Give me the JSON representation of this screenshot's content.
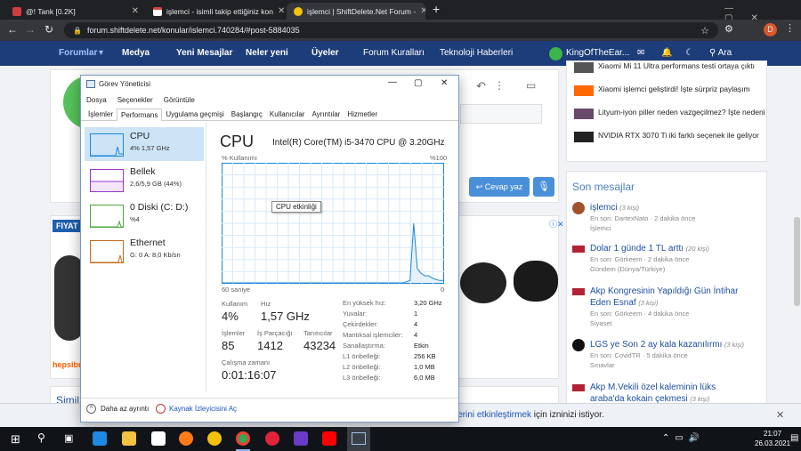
{
  "browser": {
    "tabs": [
      {
        "title": "@! Tank [0.2K]",
        "fav": "#d23c3c"
      },
      {
        "title": "işlemci - isimli takip ettiğiniz kon",
        "fav": "#d44638"
      },
      {
        "title": "işlemci | ShiftDelete.Net Forum -",
        "fav": "#f4c20d"
      }
    ],
    "new_tab": "+",
    "url": "forum.shiftdelete.net/konular/islemci.740284/#post-5884035"
  },
  "nav": {
    "items": [
      "Forumlar",
      "Medya",
      "Yeni Mesajlar",
      "Neler yeni",
      "Üyeler",
      "Forum Kuralları",
      "Teknoloji Haberleri"
    ],
    "username": "KingOfTheEar...",
    "search": "Ara"
  },
  "side_top": [
    "Xiaomi Mi 11 Ultra performans testi ortaya çıktı",
    "Xiaomi işlemci geliştirdi! İşte sürpriz paylaşım",
    "Lityum-iyon piller neden vazgeçilmez? İşte nedeni",
    "NVIDIA RTX 3070 Ti iki farklı seçenek ile geliyor"
  ],
  "reply_button": "Cevap yaz",
  "recent": {
    "title": "Son mesajlar",
    "items": [
      {
        "title": "işlemci",
        "count": "(3 kişi)",
        "line1": "En son: DartexNato · 2 dakika önce",
        "line2": "İşlemci"
      },
      {
        "title": "Dolar 1 günde 1 TL arttı",
        "count": "(20 kişi)",
        "line1": "En son: Görkeem · 2 dakika önce",
        "line2": "Gündem (Dünya/Türkiye)"
      },
      {
        "title": "Akp Kongresinin Yapıldığı Gün İntihar Eden Esnaf",
        "count": "(3 kişi)",
        "line1": "En son: Görkeem · 4 dakika önce",
        "line2": "Siyaset"
      },
      {
        "title": "LGS ye Son 2 ay kala kazanılırmı",
        "count": "(3 kişi)",
        "line1": "En son: CovidTR · 5 dakika önce",
        "line2": "Sınavlar"
      },
      {
        "title": "Akp M.Vekili özel kaleminin lüks araba'da kokain çekmesi",
        "count": "(3 kişi)",
        "line1": "",
        "line2": ""
      }
    ]
  },
  "ad": {
    "label": "FIYAT",
    "brand": "hepsibur"
  },
  "similar": "Simil",
  "notification": {
    "link": "lerini etkinleştirmek",
    "rest": " için izninizi istiyor."
  },
  "taskmgr": {
    "title": "Görev Yöneticisi",
    "menu": [
      "Dosya",
      "Seçenekler",
      "Görüntüle"
    ],
    "tabs": [
      "İşlemler",
      "Performans",
      "Uygulama geçmişi",
      "Başlangıç",
      "Kullanıcılar",
      "Ayrıntılar",
      "Hizmetler"
    ],
    "resources": [
      {
        "name": "CPU",
        "sub": "4% 1,57 GHz",
        "color": "#1a86d9"
      },
      {
        "name": "Bellek",
        "sub": "2,6/5,9 GB (44%)",
        "color": "#9b35c9"
      },
      {
        "name": "0 Diski (C: D:)",
        "sub": "%4",
        "color": "#4ba83c"
      },
      {
        "name": "Ethernet",
        "sub": "G: 0 A: 8,0 Kb/sn",
        "color": "#c66a1c"
      }
    ],
    "heading": "CPU",
    "model": "Intel(R) Core(TM) i5-3470 CPU @ 3.20GHz",
    "usage_label": "% Kullanımı",
    "usage_max": "%100",
    "time_left": "60 saniye",
    "time_right": "0",
    "tooltip": "CPU etkinliği",
    "graph": [
      0,
      0,
      0,
      0,
      0,
      0,
      0,
      0,
      0,
      0,
      0,
      0,
      0,
      0,
      0,
      0,
      0,
      0,
      0,
      0,
      0,
      0,
      0,
      0,
      0,
      0,
      0,
      0,
      0,
      0,
      0,
      0,
      0,
      0,
      0,
      0,
      0,
      0,
      0,
      0,
      0,
      0,
      0,
      0,
      0,
      0,
      0,
      0,
      0,
      0,
      1,
      2,
      50,
      12,
      8,
      6,
      6,
      4,
      3,
      2,
      2
    ],
    "stats": [
      {
        "label": "Kullanım",
        "value": "4%"
      },
      {
        "label": "Hız",
        "value": "1,57 GHz"
      },
      {
        "label": "İşlemler",
        "value": "85"
      },
      {
        "label": "İş Parçacığı",
        "value": "1412"
      },
      {
        "label": "Tanıtıcılar",
        "value": "43234"
      }
    ],
    "uptime_label": "Çalışma zamanı",
    "uptime": "0:01:16:07",
    "specs": [
      [
        "En yüksek hız:",
        "3,20 GHz"
      ],
      [
        "Yuvalar:",
        "1"
      ],
      [
        "Çekirdekler:",
        "4"
      ],
      [
        "Mantıksal işlemciler:",
        "4"
      ],
      [
        "Sanallaştırma:",
        "Etkin"
      ],
      [
        "L1 önbelleği:",
        "256 KB"
      ],
      [
        "L2 önbelleği:",
        "1,0 MB"
      ],
      [
        "L3 önbelleği:",
        "6,0 MB"
      ]
    ],
    "footer": [
      "Daha az ayrıntı",
      "Kaynak İzleyicisini Aç"
    ]
  },
  "clock": {
    "time": "21:07",
    "date": "26.03.2021"
  }
}
